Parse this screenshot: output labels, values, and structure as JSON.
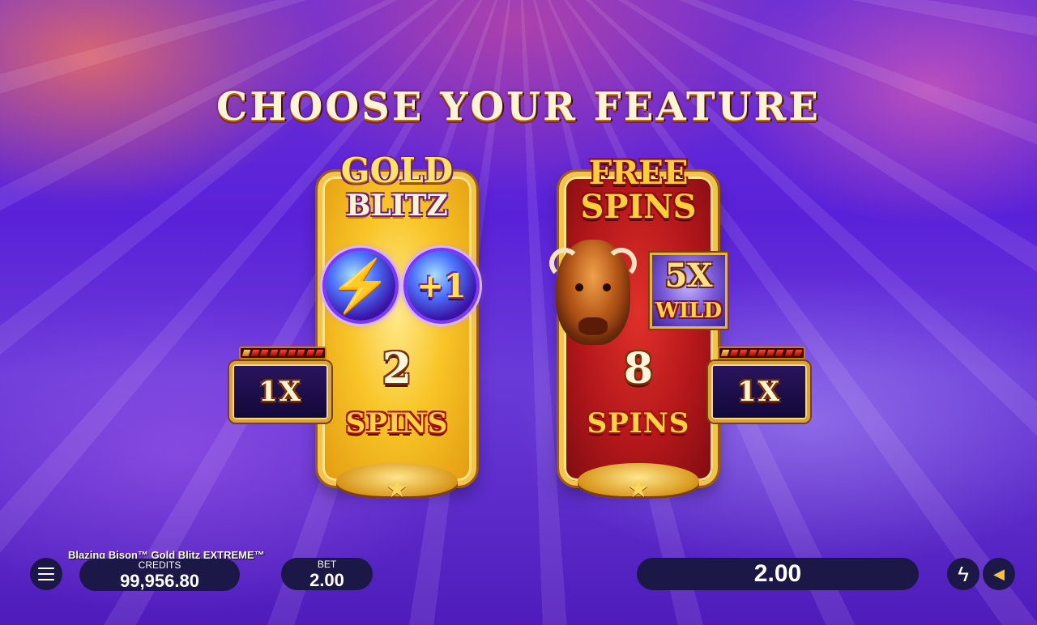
{
  "screen": {
    "title": "CHOOSE YOUR FEATURE"
  },
  "features": {
    "gold_blitz": {
      "logo_line1": "GOLD",
      "logo_line2": "BLITZ",
      "coin_bolt": "⚡",
      "coin_plus": "+1",
      "spins_count": "2",
      "spins_label": "SPINS",
      "multiplier": "1X"
    },
    "free_spins": {
      "logo_line1": "FREE",
      "logo_line2": "SPINS",
      "wild_multiplier": "5X",
      "wild_word": "WILD",
      "spins_count": "8",
      "spins_label": "SPINS",
      "multiplier": "1X"
    }
  },
  "hud": {
    "game_title": "Blazing Bison™ Gold Blitz EXTREME™",
    "credits_label": "CREDITS",
    "credits_value": "99,956.80",
    "bet_label": "BET",
    "bet_value": "2.00",
    "win_value": "2.00",
    "icons": {
      "menu": "menu-icon",
      "turbo": "lightning-icon",
      "sound": "speaker-icon"
    }
  },
  "colors": {
    "background": "#5a22d8",
    "gold_card": "#f8c528",
    "red_card": "#b4171b",
    "hud_pill": "#1b1747"
  }
}
